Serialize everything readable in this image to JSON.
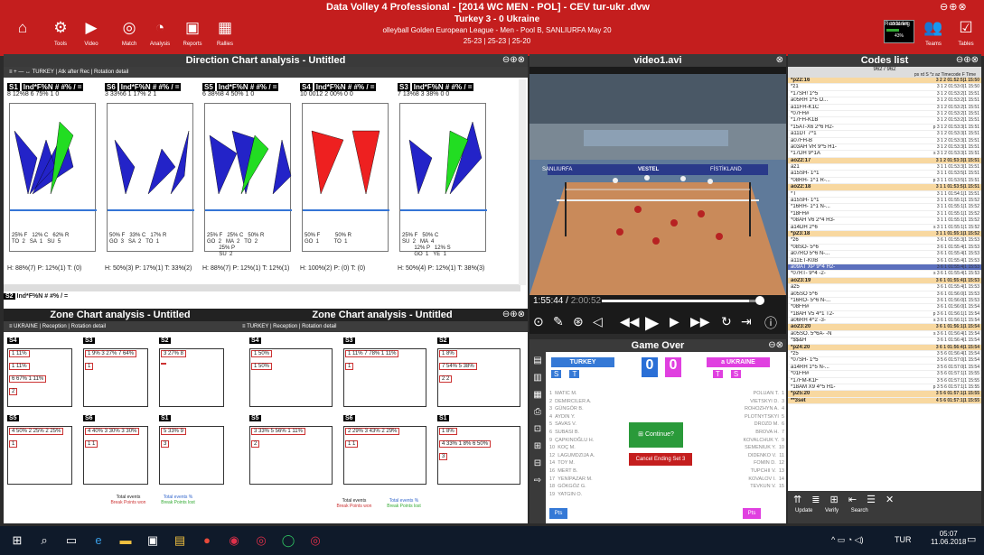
{
  "app": {
    "title": "Data Volley 4 Professional - [2014 WC MEN - POL] - CEV tur-ukr .dvw",
    "window_controls": "⊖⊕⊗"
  },
  "toolbar": {
    "left": [
      {
        "icon": "home-icon",
        "glyph": "⌂",
        "label": ""
      },
      {
        "icon": "gear-icon",
        "glyph": "⚙",
        "label": "Tools"
      },
      {
        "icon": "video-icon",
        "glyph": "▶",
        "label": "Video"
      },
      {
        "icon": "match-icon",
        "glyph": "◎",
        "label": "Match"
      },
      {
        "icon": "analysis-icon",
        "glyph": "◔",
        "label": "Analysis"
      },
      {
        "icon": "reports-icon",
        "glyph": "▣",
        "label": "Reports"
      },
      {
        "icon": "rallies-icon",
        "glyph": "▦",
        "label": "Rallies"
      }
    ],
    "right": [
      {
        "icon": "rendering-icon",
        "glyph": "",
        "label": "Rendering"
      },
      {
        "icon": "teams-icon",
        "glyph": "👥",
        "label": "Teams"
      },
      {
        "icon": "tables-icon",
        "glyph": "☑",
        "label": "Tables"
      }
    ],
    "progress_label": "10:11 left",
    "progress_pct": "43%"
  },
  "match": {
    "score": "Turkey 3 - 0 Ukraine",
    "league": "olleyball Golden European League - Men - Pool B, SANLIURFA May 20",
    "sets": "25-23 | 25-23 | 25-20"
  },
  "direction": {
    "title": "Direction Chart analysis - Untitled",
    "toolbar": "TURKEY  |  Atk after Rec  |  Rotation detail",
    "blocks": [
      {
        "rot": "S1",
        "hdr": "Ind*F%N # #%  /  =",
        "hdr2": "8 12%8 6 75% 1 0",
        "zones": "25% F   12% C   62% R\nTO  2   SA  1   SU  5",
        "stats": "H: 88%(7)  P: 12%(1)  T: (0)"
      },
      {
        "rot": "S6",
        "hdr": "Ind*F%N # #%  /  =",
        "hdr2": "3 33%6 1 17% 2 1",
        "zones": "50% F   33% C   17% R\nGO  3   SA  2   TO  1",
        "stats": "H: 50%(3)  P: 17%(1)  T: 33%(2)"
      },
      {
        "rot": "S5",
        "hdr": "Ind*F%N # #%  /  =",
        "hdr2": "6 38%8 4 50% 1 0",
        "zones": "25% F   25% C   50% R\nGO  2   MA  2   TO  2\n        25% P\n        SU  2",
        "stats": "H: 88%(7)  P: 12%(1)  T: 12%(1)"
      },
      {
        "rot": "S4",
        "hdr": "Ind*F%N # #%  /  =",
        "hdr2": "10 0012 2 00% 0 0",
        "zones": "50% F          50% R\nGO  1          TO  1",
        "stats": "H: 100%(2)  P: (0)  T: (0)"
      },
      {
        "rot": "S3",
        "hdr": "Ind*F%N # #%  /  =",
        "hdr2": "7 13%8 3 38% 0 0",
        "zones": "25% F   50% C\nSU  2   MA  4\n        12% P   12% S\n        GO  1   YE  1",
        "stats": "H: 50%(4)  P: 12%(1)  T: 38%(3)"
      }
    ],
    "bottom_rot": "S2",
    "bottom_hdr": "Ind*F%N # #%  /  ="
  },
  "video": {
    "title": "video1.avi",
    "time": "1:55:44",
    "duration": "2:00:52",
    "board_left": "SANLIURFA",
    "board_right": "FİSTİKLAND",
    "board_mid": "VESTEL"
  },
  "codes": {
    "title": "Codes list",
    "count": "962 / 962",
    "header": "ps rd S *z az  Timecode  F  Time",
    "rows": [
      {
        "c": "*p22:16",
        "t": "3 2 2 01:52:5|1 15:50",
        "k": "hl"
      },
      {
        "c": "*z1",
        "t": "3 1 2 01:53:0|1 15:50",
        "k": ""
      },
      {
        "c": "*17SH!   1^5",
        "t": "3 1 2 01:53:2|1 15:51",
        "k": ""
      },
      {
        "c": "a05RH    1^5  O...",
        "t": "3 1 2 01:53:2|1 15:51",
        "k": ""
      },
      {
        "c": "a11FH-K1C",
        "t": "3 1 2 01:53:2|1 15:51",
        "k": ""
      },
      {
        "c": "*07FH#",
        "t": "3 1 2 01:53:2|1 15:51",
        "k": ""
      },
      {
        "c": "*17FH-K1B",
        "t": "3 1 2 01:53:2|1 15:51",
        "k": ""
      },
      {
        "c": "*15AT-X6 2^6  H2-",
        "t": "p 3 1 2 01:53:3|1 15:51",
        "k": ""
      },
      {
        "c": "a11DT    7^1",
        "t": "3 1 2 01:53:3|1 15:51",
        "k": ""
      },
      {
        "c": "a07FH-B",
        "t": "3 1 2 01:53:3|1 15:51",
        "k": ""
      },
      {
        "c": "a03AH VR 9^5  H1-",
        "t": "3 1 2 01:53:3|1 15:51",
        "k": ""
      },
      {
        "c": "*17DH    9^1A",
        "t": "s 3 1 2 01:53:3|1 15:51",
        "k": ""
      },
      {
        "c": "ao22:17",
        "t": "3 1 2 01:53:3|1 15:51",
        "k": "hl"
      },
      {
        "c": "az1",
        "t": "3 1 1 01:53:3|1 15:51",
        "k": ""
      },
      {
        "c": "a15SH-   1^1",
        "t": "3 1 1 01:53:5|1 15:51",
        "k": ""
      },
      {
        "c": "*08RH-   1^1  R-...",
        "t": "p 3 1 1 01:53:5|1 15:51",
        "k": ""
      },
      {
        "c": "ao22:18",
        "t": "3 1 1 01:53:5|1 15:51",
        "k": "hl"
      },
      {
        "c": "*T",
        "t": "3 1 1 01:54:1|1 15:51",
        "k": ""
      },
      {
        "c": "a15SH-   1^1",
        "t": "3 1 1 01:55:1|1 15:52",
        "k": ""
      },
      {
        "c": "*16RH-   1^1  N-...",
        "t": "3 1 1 01:55:1|1 15:52",
        "k": ""
      },
      {
        "c": "*18FH#",
        "t": "3 1 1 01:55:1|1 15:52",
        "k": ""
      },
      {
        "c": "*08AH V6 2^4  H3-",
        "t": "3 1 1 01:55:1|1 15:52",
        "k": ""
      },
      {
        "c": "a14DH    2^6",
        "t": "s 3 1 1 01:55:1|1 15:52",
        "k": ""
      },
      {
        "c": "*p23:18",
        "t": "3 1 1 01:55:1|1 15:52",
        "k": "hl"
      },
      {
        "c": "*z6",
        "t": "3 6 1 01:55:3|1 15:53",
        "k": ""
      },
      {
        "c": "*08SO-   5^6",
        "t": "3 6 1 01:55:4|1 15:53",
        "k": ""
      },
      {
        "c": "a07RO    5^6  N-...",
        "t": "3 6 1 01:55:4|1 15:53",
        "k": ""
      },
      {
        "c": "a11ET-K0B",
        "t": "3 6 1 01:55:4|1 15:53",
        "k": ""
      },
      {
        "c": "a09AT XP 9^4  H2-",
        "t": "3 6 1 01:55:4|1 15:53",
        "k": "sel"
      },
      {
        "c": "*07RT-   9^4  -2-",
        "t": "s 3 6 1 01:55:4|1 15:53",
        "k": ""
      },
      {
        "c": "ao23:19",
        "t": "3 6 1 01:55:4|1 15:53",
        "k": "hl"
      },
      {
        "c": "az5",
        "t": "3 6 1 01:55:4|1 15:53",
        "k": ""
      },
      {
        "c": "a05SO    5^6",
        "t": "3 6 1 01:56:0|1 15:53",
        "k": ""
      },
      {
        "c": "*16RO-   5^6  N-...",
        "t": "3 6 1 01:56:0|1 15:53",
        "k": ""
      },
      {
        "c": "*08FH#",
        "t": "3 6 1 01:56:0|1 15:54",
        "k": ""
      },
      {
        "c": "*18AH V5 4^1  T2-",
        "t": "p 3 6 1 01:56:1|1 15:54",
        "k": ""
      },
      {
        "c": "a06RH    4^2  -3-",
        "t": "s 3 6 1 01:56:1|1 15:54",
        "k": ""
      },
      {
        "c": "ao23:20",
        "t": "3 6 1 01:56:1|1 15:54",
        "k": "hl"
      },
      {
        "c": "a05SO.   5^6A- -N",
        "t": "s 3 6 1 01:56:4|1 15:54",
        "k": ""
      },
      {
        "c": "*$$&H",
        "t": "3 6 1 01:56:4|1 15:54",
        "k": ""
      },
      {
        "c": "*p24:20",
        "t": "3 6 1 01:56:4|1 15:54",
        "k": "hl"
      },
      {
        "c": "*z5",
        "t": "3 5 6 01:56:4|1 15:54",
        "k": ""
      },
      {
        "c": "*07SH-   1^5",
        "t": "3 5 6 01:57:0|1 15:54",
        "k": ""
      },
      {
        "c": "a14RH    1^5  N-...",
        "t": "3 5 6 01:57:0|1 15:54",
        "k": ""
      },
      {
        "c": "*01FH#",
        "t": "3 5 6 01:57:1|1 15:55",
        "k": ""
      },
      {
        "c": "*17FM-K1F",
        "t": "3 5 6 01:57:1|1 15:55",
        "k": ""
      },
      {
        "c": "*18AM X9 4^5  H1-",
        "t": "p 3 5 6 01:57:1|1 15:55",
        "k": ""
      },
      {
        "c": "*p25:20",
        "t": "3 5 6 01:57:1|1 15:55",
        "k": "hl"
      },
      {
        "c": "**3set",
        "t": "4 5 6 01:57:1|1 15:55",
        "k": "hl"
      }
    ],
    "footer": [
      "Update",
      "Verify",
      "Search"
    ]
  },
  "zone1": {
    "title": "Zone Chart analysis - Untitled",
    "toolbar": "UKRAINE  |  Reception  |  Rotation detail",
    "cells": [
      {
        "rot": "S4",
        "v": [
          "1  11%",
          "1  11%",
          "6  67%  1  11%",
          "2"
        ]
      },
      {
        "rot": "S3",
        "v": [
          "1  9%  3  27%  7  64%",
          "1"
        ]
      },
      {
        "rot": "S2",
        "v": [
          "3  27%  8",
          ""
        ]
      },
      {
        "rot": "S5",
        "v": [
          "4  50%  2  25%  2  25%",
          "1"
        ]
      },
      {
        "rot": "S6",
        "v": [
          "4  40%  3  30%  3  30%",
          "1   1"
        ]
      },
      {
        "rot": "S1",
        "v": [
          "5  33%  9",
          "3"
        ]
      }
    ],
    "footer_a": "Total events",
    "footer_b": "Break Points won",
    "footer_c": "Total events %",
    "footer_d": "Break Points lost"
  },
  "zone2": {
    "title": "Zone Chart analysis - Untitled",
    "toolbar": "TURKEY  |  Reception  |  Rotation detail",
    "cells": [
      {
        "rot": "S4",
        "v": [
          "1  50%",
          "1  50%"
        ]
      },
      {
        "rot": "S3",
        "v": [
          "1  11%  7  78%  1  11%",
          "1"
        ]
      },
      {
        "rot": "S2",
        "v": [
          "1  8%",
          "7  54%  5  38%",
          "2     2"
        ]
      },
      {
        "rot": "S5",
        "v": [
          "3  33%  5  56%  1  11%",
          "2"
        ]
      },
      {
        "rot": "S6",
        "v": [
          "2  29%  3  43%  2  29%",
          "1       1"
        ]
      },
      {
        "rot": "S1",
        "v": [
          "1  8%",
          "4  33%  1  8%  6  50%",
          "3"
        ]
      }
    ],
    "footer_a": "Total events",
    "footer_b": "Break Points won",
    "footer_c": "Total events %",
    "footer_d": "Break Points lost"
  },
  "game": {
    "title": "Game Over",
    "team_a": "TURKEY",
    "team_b": "a UKRAINE",
    "score_a": "0",
    "score_b": "0",
    "players_a": [
      "MATIC M.",
      "DEMIRCILER A.",
      "GÜNGÖR B.",
      "AYDIN Y.",
      "SAVAS V.",
      "SUBASI B.",
      "ÇAPKINOĞLU H.",
      "KOÇ M.",
      "LAGUMDZIJA A.",
      "TOY M.",
      "MERT B.",
      "YENİPAZAR M.",
      "GÖKGÖZ G.",
      "YATGIN O."
    ],
    "nums_a": [
      "1",
      "2",
      "3",
      "4",
      "5",
      "6",
      "9",
      "10",
      "12",
      "14",
      "16",
      "17",
      "18",
      "19"
    ],
    "players_b": [
      "POLUAN T.",
      "VIETSKYI D.",
      "ROHOZHYN A.",
      "PLOTNYTSKYI",
      "DROZD M.",
      "BROVA H.",
      "KOVALCHUK Y.",
      "SEMENIUK Y.",
      "DIDENKO V.",
      "FOMIN D.",
      "TUPCHII V.",
      "KOVALOV I.",
      "TEVKUN V."
    ],
    "nums_b": [
      "1",
      "3",
      "4",
      "5",
      "6",
      "7",
      "9",
      "10",
      "11",
      "12",
      "13",
      "14",
      "15"
    ],
    "continue": "Continue?",
    "cancel": "Cancel Ending Set 3",
    "pts": "Pts"
  },
  "taskbar": {
    "lang": "TUR",
    "time": "05:07",
    "date": "11.06.2018"
  }
}
